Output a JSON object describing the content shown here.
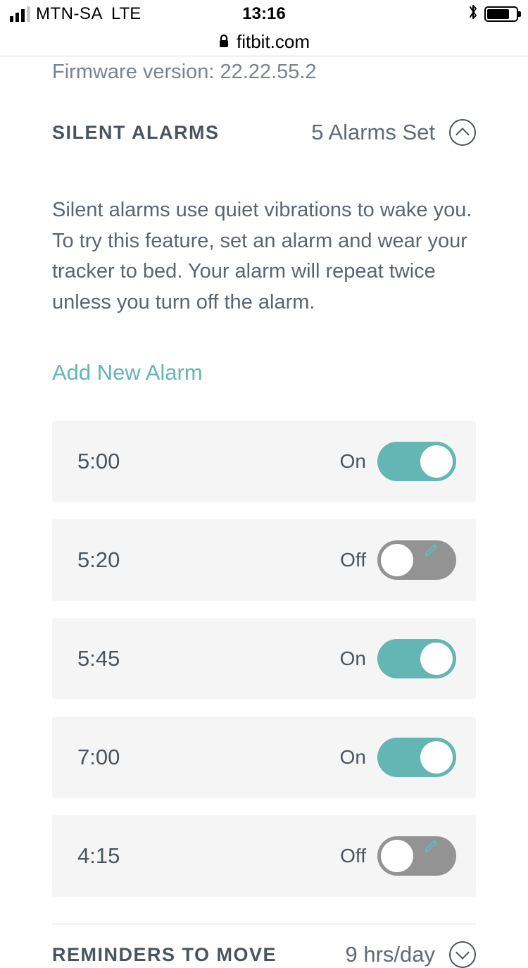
{
  "statusBar": {
    "carrier": "MTN-SA",
    "network": "LTE",
    "time": "13:16"
  },
  "urlBar": {
    "domain": "fitbit.com"
  },
  "firmware": {
    "label": "Firmware version:",
    "version": "22.22.55.2"
  },
  "silentAlarms": {
    "title": "SILENT ALARMS",
    "count": "5 Alarms Set",
    "description": "Silent alarms use quiet vibrations to wake you. To try this feature, set an alarm and wear your tracker to bed. Your alarm will repeat twice unless you turn off the alarm.",
    "addLabel": "Add New Alarm",
    "onLabel": "On",
    "offLabel": "Off",
    "alarms": [
      {
        "time": "5:00",
        "on": true
      },
      {
        "time": "5:20",
        "on": false
      },
      {
        "time": "5:45",
        "on": true
      },
      {
        "time": "7:00",
        "on": true
      },
      {
        "time": "4:15",
        "on": false
      }
    ]
  },
  "reminders": {
    "title": "REMINDERS TO MOVE",
    "value": "9 hrs/day"
  }
}
